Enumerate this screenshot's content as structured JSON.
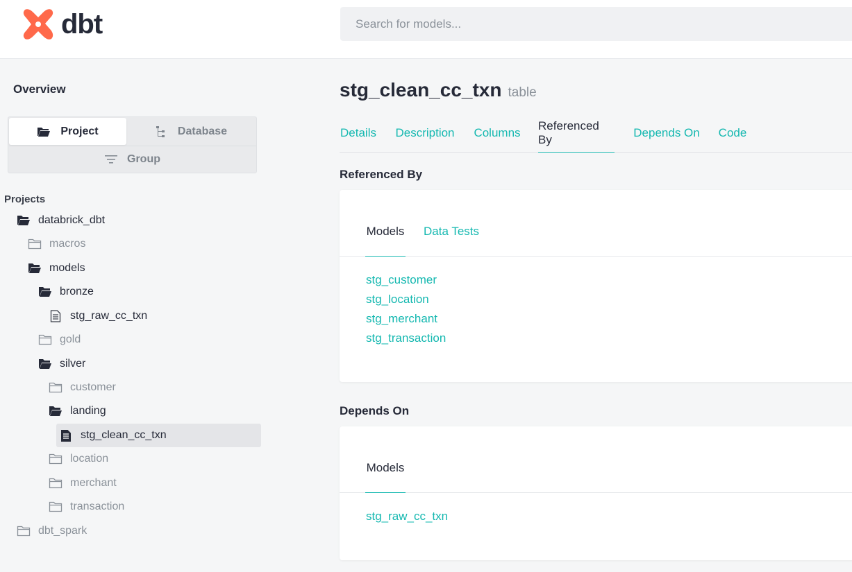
{
  "header": {
    "brand": "dbt",
    "search_placeholder": "Search for models..."
  },
  "sidebar": {
    "overview": "Overview",
    "switcher": {
      "project": "Project",
      "database": "Database",
      "group": "Group"
    },
    "projects_label": "Projects",
    "tree": [
      {
        "label": "databrick_dbt",
        "type": "folder-open"
      },
      {
        "label": "macros",
        "type": "folder-closed"
      },
      {
        "label": "models",
        "type": "folder-open"
      },
      {
        "label": "bronze",
        "type": "folder-open"
      },
      {
        "label": "stg_raw_cc_txn",
        "type": "file"
      },
      {
        "label": "gold",
        "type": "folder-closed"
      },
      {
        "label": "silver",
        "type": "folder-open"
      },
      {
        "label": "customer",
        "type": "folder-closed"
      },
      {
        "label": "landing",
        "type": "folder-open"
      },
      {
        "label": "stg_clean_cc_txn",
        "type": "file-selected"
      },
      {
        "label": "location",
        "type": "folder-closed"
      },
      {
        "label": "merchant",
        "type": "folder-closed"
      },
      {
        "label": "transaction",
        "type": "folder-closed"
      },
      {
        "label": "dbt_spark",
        "type": "folder-closed"
      }
    ]
  },
  "main": {
    "title": "stg_clean_cc_txn",
    "type_label": "table",
    "tabs": [
      "Details",
      "Description",
      "Columns",
      "Referenced By",
      "Depends On",
      "Code"
    ],
    "active_tab": "Referenced By",
    "referenced_by": {
      "heading": "Referenced By",
      "tabs": [
        "Models",
        "Data Tests"
      ],
      "items": [
        "stg_customer",
        "stg_location",
        "stg_merchant",
        "stg_transaction"
      ]
    },
    "depends_on": {
      "heading": "Depends On",
      "tabs": [
        "Models"
      ],
      "items": [
        "stg_raw_cc_txn"
      ]
    }
  },
  "colors": {
    "accent": "#14b8b0",
    "logo": "#ff694a",
    "text": "#262a38",
    "muted": "#8a9199"
  }
}
